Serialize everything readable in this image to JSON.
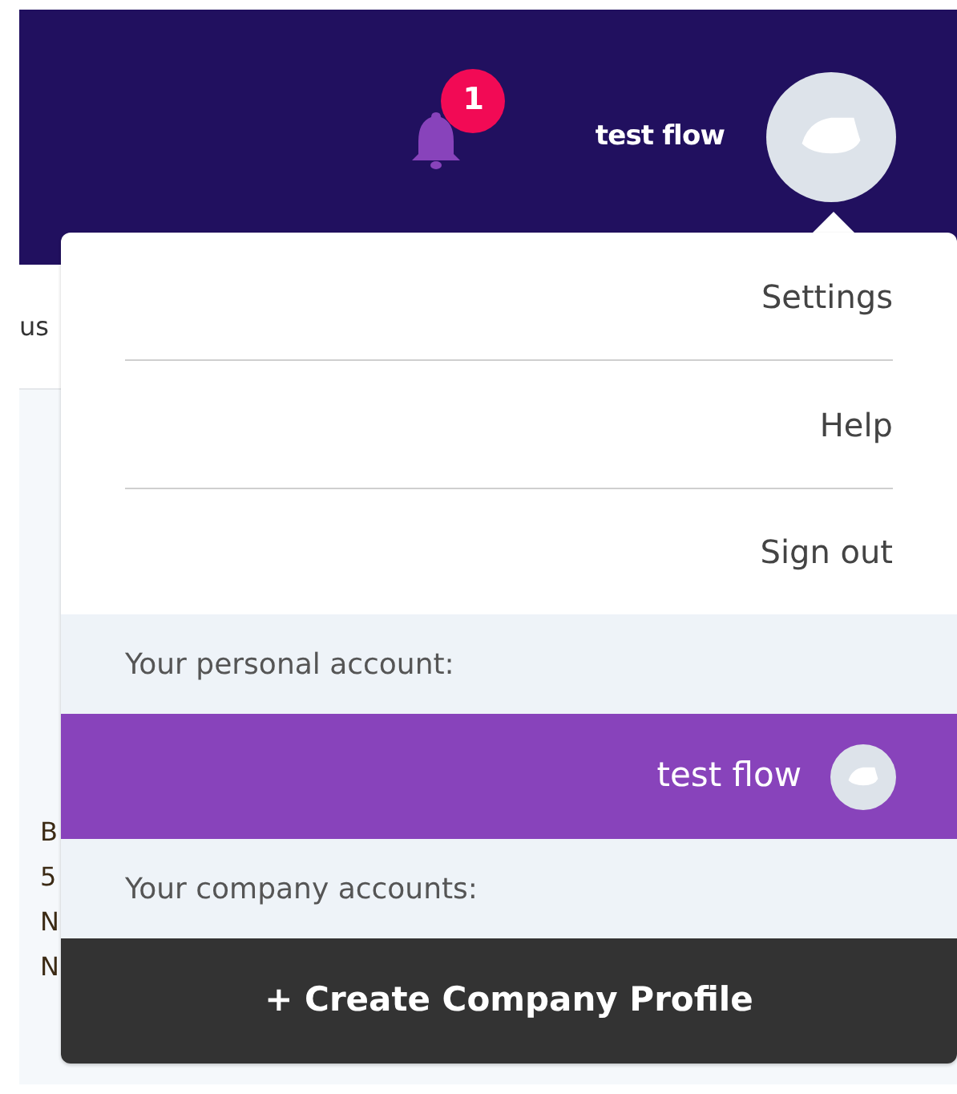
{
  "header": {
    "notifications": {
      "count": "1"
    },
    "user_name": "test flow"
  },
  "page": {
    "tab_fragment": "us",
    "text_fragments": [
      "B",
      "5",
      "N",
      "N"
    ]
  },
  "dropdown": {
    "items": [
      {
        "label": "Settings"
      },
      {
        "label": "Help"
      },
      {
        "label": "Sign out"
      }
    ],
    "personal_heading": "Your personal account:",
    "personal_accounts": [
      {
        "name": "test flow",
        "selected": true
      }
    ],
    "company_heading": "Your company accounts:",
    "create_button": "+ Create Company Profile"
  }
}
